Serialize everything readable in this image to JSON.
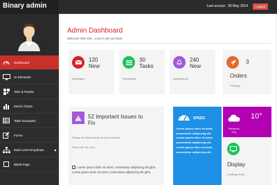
{
  "app": {
    "brand": "Binary admin"
  },
  "topbar": {
    "last_access": "Last access : 30 May 2014",
    "logout_label": "Logout"
  },
  "sidebar": {
    "items": [
      {
        "label": "Dashboard",
        "icon": "dashboard-icon",
        "active": true
      },
      {
        "label": "UI Elements",
        "icon": "desktop-icon"
      },
      {
        "label": "Tabs & Panels",
        "icon": "qrcode-icon"
      },
      {
        "label": "Morris Charts",
        "icon": "bar-chart-icon"
      },
      {
        "label": "Table Examples",
        "icon": "table-icon"
      },
      {
        "label": "Forms",
        "icon": "edit-icon"
      },
      {
        "label": "Multi-Level Dropdown",
        "icon": "sitemap-icon"
      },
      {
        "label": "Blank Page",
        "icon": "square-icon"
      }
    ]
  },
  "main": {
    "title": "Admin Dashboard",
    "subtitle": "Welcome Jhon Deo , Love to see you back.",
    "stats": [
      {
        "value": "120",
        "unit": "New",
        "caption": "Messages",
        "color": "#d9222a",
        "icon": "envelope-icon"
      },
      {
        "value": "30",
        "unit": "Tasks",
        "caption": "Remaining",
        "color": "#1ec25a",
        "icon": "list-icon"
      },
      {
        "value": "240",
        "unit": "New",
        "caption": "Notifications",
        "color": "#a259d9",
        "icon": "bell-icon"
      },
      {
        "value": "3",
        "unit": "Orders",
        "caption": "Pending",
        "color": "#e36a2e",
        "icon": "rocket-icon"
      }
    ],
    "issues": {
      "title_line1": "52 Important Issues to",
      "title_line2": "Fix",
      "line1": "Please fix these issues to work smooth",
      "line2": "Time Left: 30 mins",
      "body": "Lorem ipsum dolor sit amet, consectetur adipiscing elit gthn. Lorem ipsum dolor sit amet, consectetur adipiscing elit gthn."
    },
    "speed": {
      "title": "SPEED",
      "body": "Lorem ipsum dolor sit amet, consectetur adipiscing elit. Lorem ipsum dolor sit amet, consectetur adipiscing elit. Lorem ipsum dolor sit amet, consectetur adipiscing elit."
    },
    "weather": {
      "temp": "10°",
      "city_line1": "Newyork",
      "city_line2": "City"
    },
    "display": {
      "title": "Display",
      "subtitle": "Looking Good"
    }
  }
}
